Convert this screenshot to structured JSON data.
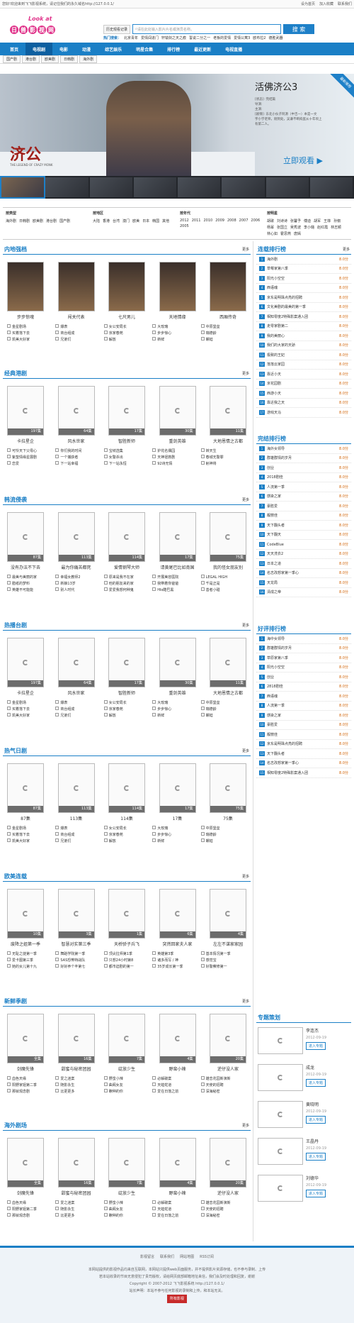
{
  "topbar": {
    "notice": "您好!欢迎来到飞飞影视系统，请记住我们的永久域名http://127.0.0.1/",
    "links": [
      "设为首页",
      "加入收藏",
      "联系我们"
    ]
  },
  "logo": {
    "top": "Look at",
    "chars": [
      "日",
      "兽",
      "影",
      "视",
      "网"
    ]
  },
  "search": {
    "history": "历史观看记录",
    "placeholder": "请在此处输入影片片名或演员名称。",
    "button": "搜 索"
  },
  "hot": {
    "label": "热门搜索：",
    "items": [
      "北京青年",
      "爱情闯进门",
      "轩辕剑之天之痕",
      "誓说二分之一",
      "老板的爱情",
      "爱情公寓3",
      "欧布拉2",
      "德胜武器"
    ]
  },
  "nav": [
    "首页",
    "电视剧",
    "电影",
    "动漫",
    "综艺娱乐",
    "明星合集",
    "排行榜",
    "最近更新",
    "电视直播"
  ],
  "subnav": [
    "国产剧",
    "港台剧",
    "欧美剧",
    "日韩剧",
    "海外剧"
  ],
  "banner": {
    "title": "活佛济公3",
    "logo_text": "济公",
    "en": "THE LEGEND OF CRAZY MONK",
    "lines": [
      "[状态]: 完结篇",
      "导演:",
      "主演:",
      "[剧情]: 东北小伙子阿源（中吉一）本是一文",
      "字小学老师，刚到处，吴谦不断捣蛋从十年坝上",
      "有第二人。"
    ],
    "watch": "立即观看",
    "ribbon": "最新推荐"
  },
  "filters": [
    {
      "head": "按类型",
      "items": [
        "海外剧",
        "日韩剧",
        "欧美剧",
        "港台剧",
        "国产剧"
      ]
    },
    {
      "head": "按地区",
      "items": [
        "大陆",
        "香港",
        "台湾",
        "澳门",
        "欧美",
        "日本",
        "韩国",
        "其他"
      ]
    },
    {
      "head": "按年代",
      "items": [
        "2012",
        "2011",
        "2010",
        "2009",
        "2008",
        "2007",
        "2006",
        "2005"
      ]
    },
    {
      "head": "按明星",
      "items": [
        "胡歌",
        "刘诗诗",
        "张馨予",
        "傅迪",
        "胡军",
        "王菲",
        "孙俪",
        "杨幂",
        "张国立",
        "吴秀波",
        "李小璐",
        "赵红霞",
        "林志颖",
        "林心如",
        "霍思燕",
        "唐嫣"
      ]
    }
  ],
  "sections": [
    {
      "title": "内地强档",
      "more": "更多",
      "posters": [
        {
          "name": "步步惊魂",
          "tag": ""
        },
        {
          "name": "闯关代表",
          "tag": ""
        },
        {
          "name": "七尺男儿",
          "tag": ""
        },
        {
          "name": "天地情缘",
          "tag": ""
        },
        {
          "name": "西厢传奇",
          "tag": ""
        }
      ],
      "list": [
        "金星剧场",
        "爆表",
        "女公安局长",
        "大玫瑰",
        "中原堡垒",
        "买着落下去",
        "商台组成",
        "京家春苑",
        "步步惊心",
        "瑞德龄",
        "凯美大好家",
        "兄弟们",
        "解放",
        "新鲜",
        "螺蛙"
      ]
    },
    {
      "title": "经典港剧",
      "more": "更多",
      "posters": [
        {
          "name": "卡拉星企",
          "tag": "197集"
        },
        {
          "name": "风水世家",
          "tag": "64集"
        },
        {
          "name": "智胜新师",
          "tag": "17集"
        },
        {
          "name": "重剑英雄",
          "tag": "30集"
        },
        {
          "name": "大地恩情之古都",
          "tag": "11集"
        }
      ],
      "list": [
        "可怜天下父母心",
        "你们我的时间",
        "宝岐选集",
        "护花名偶园",
        "转天生",
        "紫蛰情缘星展剧",
        "一个捕获者",
        "女警杀出",
        "天神拯救剧",
        "春城无警罪",
        "恋爱",
        "下一站幸福",
        "下一站永恒",
        "92诗无情",
        "射神将"
      ]
    },
    {
      "title": "韩流侵袭",
      "more": "更多",
      "posters": [
        {
          "name": "没有办法不下去",
          "tag": "87集"
        },
        {
          "name": "最为你痛苦都死",
          "tag": "113集"
        },
        {
          "name": "爱情钢琴大师",
          "tag": "114集"
        },
        {
          "name": "请黄尾巴比如南国",
          "tag": "17集"
        },
        {
          "name": "我的怪女朋友别",
          "tag": "75集"
        }
      ],
      "list": [
        "最美与美丽的家",
        "幸福女教师2",
        "原来是我不在家",
        "开展美容医院",
        "LEGAL HIGH",
        "腊纸的梦料",
        "新娘13岁",
        "他的朋友来的家",
        "我带着你爸爸",
        "千是正是",
        "英雄不可能能",
        "别人时代",
        "爱爱我想何种鬼",
        "Hlo酷巴黑",
        "善者小碰"
      ]
    },
    {
      "title": "热播台剧",
      "more": "更多",
      "posters": [
        {
          "name": "卡拉星企",
          "tag": "197集"
        },
        {
          "name": "风水世家",
          "tag": "64集"
        },
        {
          "name": "智胜新师",
          "tag": "17集"
        },
        {
          "name": "重剑英雄",
          "tag": "30集"
        },
        {
          "name": "大地恩情之古都",
          "tag": "11集"
        }
      ],
      "list": [
        "金星剧场",
        "爆表",
        "女公安局长",
        "大玫瑰",
        "中原堡垒",
        "买着落下去",
        "商台组成",
        "京家春苑",
        "步步惊心",
        "瑞德龄",
        "凯美大好家",
        "兄弟们",
        "解放",
        "新鲜",
        "螺蛙"
      ]
    },
    {
      "title": "热气日剧",
      "more": "更多",
      "posters": [
        {
          "name": "87集",
          "tag": "87集"
        },
        {
          "name": "113集",
          "tag": "113集"
        },
        {
          "name": "114集",
          "tag": "114集"
        },
        {
          "name": "17集",
          "tag": "17集"
        },
        {
          "name": "75集",
          "tag": "75集"
        }
      ],
      "list": [
        "金星剧场",
        "爆表",
        "女公安局长",
        "大玫瑰",
        "中原堡垒",
        "买着落下去",
        "商台组成",
        "京家春苑",
        "步步惊心",
        "瑞德龄",
        "凯美大好家",
        "兄弟们",
        "解放",
        "新鲜",
        "螺蛙"
      ]
    },
    {
      "title": "欧美连载",
      "more": "更多",
      "posters": [
        {
          "name": "废降之姐第一季",
          "tag": "10集"
        },
        {
          "name": "智慧对实第三季",
          "tag": "3集"
        },
        {
          "name": "天桥骄子兵飞",
          "tag": "1集"
        },
        {
          "name": "突然回家夫人家",
          "tag": "6集"
        },
        {
          "name": "左左不谋家家园",
          "tag": "4集"
        }
      ],
      "list": [
        "无耻之徒第一季",
        "舞蹈学院第一季",
        "顶尖拉师第1季",
        "英雄第3季",
        "基本情况第一季",
        "爱卡图第三季",
        "SAS恐怖特战队",
        "只想24小时第8",
        "诸多而写 / 神",
        "感觉宝",
        "她的女儿第十九",
        "好好养个丰第七",
        "都市迫剧的第一",
        "35岁成长第一季",
        "好警察修第一"
      ]
    },
    {
      "title": "新鲜季剧",
      "more": "更多",
      "posters": [
        {
          "name": "剑魔先锋",
          "tag": "全集"
        },
        {
          "name": "甜蜜与秘密团园",
          "tag": "16集"
        },
        {
          "name": "绽放少生",
          "tag": "7集"
        },
        {
          "name": "野蛮小辣",
          "tag": "4集"
        },
        {
          "name": "逆仔没人家",
          "tag": "20集"
        }
      ],
      "list": [
        "血色天缘",
        "爱之迷案",
        "野蛮小辣",
        "必解破案",
        "雄恋花园新演新",
        "阳野家姐第二季",
        "随影永生",
        "曲阁女友",
        "天蛙蛇道",
        "天使的招聘",
        "那就观念剧",
        "比更更多",
        "瞭种的你",
        "爱在日落之前",
        "深海秘密"
      ]
    },
    {
      "title": "海外剧场",
      "more": "更多",
      "posters": [
        {
          "name": "剑魔先锋",
          "tag": "全集"
        },
        {
          "name": "甜蜜与秘密团园",
          "tag": "16集"
        },
        {
          "name": "绽放少生",
          "tag": "7集"
        },
        {
          "name": "野蛮小辣",
          "tag": "4集"
        },
        {
          "name": "逆仔没人家",
          "tag": "20集"
        }
      ],
      "list": [
        "血色天缘",
        "爱之迷案",
        "野蛮小辣",
        "必解破案",
        "雄恋花园新演新",
        "阳野家姐第二季",
        "随影永生",
        "曲阁女友",
        "天蛙蛇道",
        "天使的招聘",
        "那就观念剧",
        "比更更多",
        "瞭种的你",
        "爱在日落之前",
        "深海秘密"
      ]
    }
  ],
  "side": [
    {
      "title": "连载排行榜",
      "more": "更多",
      "items": [
        "海外剧",
        "草莓家第八季",
        "阳光小空空",
        "西语魂",
        "京东是明珠点亮的招聘",
        "文化美剧的最美的第一季",
        "相知零度2特殊影案通入团",
        "走零家剧第二",
        "我的美丽心",
        "我们的大家的天骄",
        "极致的王妃",
        "落落云家园",
        "靠近小天",
        "京花园剧",
        "西游小天",
        "靠近我之天",
        "游戏天马"
      ],
      "score": "8.0分"
    },
    {
      "title": "完结排行榜",
      "more": "",
      "items": [
        "海外女领导",
        "群雄群情的岁月",
        "创业",
        "2018剧佳",
        "人流第一季",
        "感染之家",
        "豪胜爱",
        "靓丽佳",
        "天下翻头者",
        "天下翻天",
        "CodeBlue",
        "天天洗衣2",
        "日本之道",
        "名志改想家第一季心",
        "天龙局",
        "清成之帝"
      ],
      "score": "8.0分"
    },
    {
      "title": "好评排行榜",
      "more": "",
      "items": [
        "海中女领导",
        "群雄群情的岁月",
        "草原家第八季",
        "阳光小空空",
        "创业",
        "2818剧佳",
        "西语魂",
        "人流第一季",
        "感染之家",
        "豪胜爱",
        "靓丽佳",
        "京东是明珠点亮的招聘",
        "天下翻头者",
        "名志改想家第一季心",
        "相知零度2特殊影案通入团"
      ],
      "score": "8.0分"
    },
    {
      "title": "专题策划",
      "more": "",
      "items": []
    }
  ],
  "zt": [
    {
      "name": "李连杰",
      "date": "2012-09-19",
      "btn": "进入专题"
    },
    {
      "name": "成龙",
      "date": "2012-09-19",
      "btn": "进入专题"
    },
    {
      "name": "黄晓明",
      "date": "2012-09-19",
      "btn": "进入专题"
    },
    {
      "name": "王晶丹",
      "date": "2012-09-19",
      "btn": "进入专题"
    },
    {
      "name": "刘德华",
      "date": "2012-09-19",
      "btn": "进入专题"
    }
  ],
  "footer": {
    "links": [
      "影视留言",
      "联系我们",
      "网站地图",
      "RSS订阅"
    ],
    "l1": "本网站提供的影视作品均来自互联网，本网站只提供web页面服务，并不提供影片资源存储，也不参与录制、上传",
    "l2": "若本站收录的节目无意侵犯了贵司版权，请给网页底部邮箱地址来信，我们会及时处理和回复，谢谢",
    "copy": "Copyright © 2007-2012 飞飞影视系统 http://127.0.0.1/",
    "l3": "站长声明：本站不参与任何影视的录制和上传，和本站无关。",
    "btn": "所有影视"
  }
}
